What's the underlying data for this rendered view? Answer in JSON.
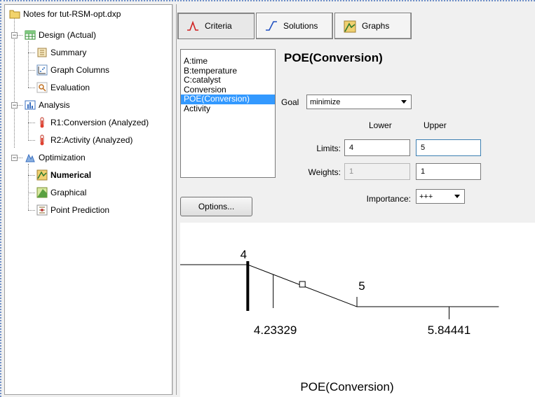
{
  "tree": {
    "root": {
      "label": "Notes for tut-RSM-opt.dxp"
    },
    "design": {
      "label": "Design (Actual)"
    },
    "summary": {
      "label": "Summary"
    },
    "graph_columns": {
      "label": "Graph Columns"
    },
    "evaluation": {
      "label": "Evaluation"
    },
    "analysis": {
      "label": "Analysis"
    },
    "r1": {
      "label": "R1:Conversion (Analyzed)"
    },
    "r2": {
      "label": "R2:Activity (Analyzed)"
    },
    "optimization": {
      "label": "Optimization"
    },
    "numerical": {
      "label": "Numerical"
    },
    "graphical": {
      "label": "Graphical"
    },
    "point_prediction": {
      "label": "Point Prediction"
    }
  },
  "tabs": [
    {
      "label": "Criteria",
      "active": true
    },
    {
      "label": "Solutions",
      "active": false
    },
    {
      "label": "Graphs",
      "active": false
    }
  ],
  "response_list": {
    "items": [
      "A:time",
      "B:temperature",
      "C:catalyst",
      "Conversion",
      "POE(Conversion)",
      "Activity"
    ],
    "selected_index": 4
  },
  "criteria": {
    "title": "POE(Conversion)",
    "goal_label": "Goal",
    "goal_value": "minimize",
    "lower_header": "Lower",
    "upper_header": "Upper",
    "limits_label": "Limits:",
    "limits_lower": "4",
    "limits_upper": "5",
    "weights_label": "Weights:",
    "weights_lower": "1",
    "weights_upper": "1",
    "importance_label": "Importance:",
    "importance_value": "+++"
  },
  "options_button": {
    "label": "Options..."
  },
  "chart_data": {
    "type": "line",
    "xlabel": "POE(Conversion)",
    "lower_limit": 4,
    "upper_limit": 5,
    "data_min": 4.23329,
    "data_max": 5.84441,
    "tick_labels": {
      "lower_limit": "4",
      "upper_limit": "5",
      "data_min": "4.23329",
      "data_max": "5.84441"
    },
    "desirability_segments": [
      {
        "x": 3.0,
        "d": 1
      },
      {
        "x": 4.0,
        "d": 1
      },
      {
        "x": 5.0,
        "d": 0
      },
      {
        "x": 6.3,
        "d": 0
      }
    ],
    "xlim": [
      3.15,
      6.4
    ],
    "ylim": [
      0,
      1
    ]
  }
}
